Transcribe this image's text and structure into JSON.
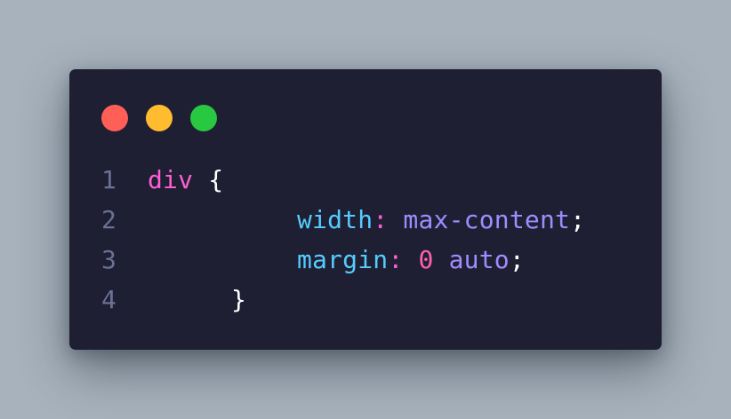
{
  "window": {
    "controls": [
      {
        "name": "close",
        "color": "#ff5f57"
      },
      {
        "name": "minimize",
        "color": "#febc2e"
      },
      {
        "name": "maximize",
        "color": "#28c840"
      }
    ]
  },
  "code": {
    "lines": [
      {
        "number": "1",
        "selector": "div",
        "open_brace": "{"
      },
      {
        "number": "2",
        "property": "width",
        "colon": ":",
        "value": "max-content",
        "semicolon": ";"
      },
      {
        "number": "3",
        "property": "margin",
        "colon": ":",
        "value_num": "0",
        "value": "auto",
        "semicolon": ";"
      },
      {
        "number": "4",
        "close_brace": "}"
      }
    ]
  },
  "colors": {
    "background": "#a7b2bd",
    "editor_bg": "#1e1f33",
    "line_number": "#6b7195",
    "selector": "#ff5fd0",
    "property": "#55ccff",
    "value": "#a08cff",
    "number": "#ff5fb0",
    "punctuation": "#ffffff"
  }
}
